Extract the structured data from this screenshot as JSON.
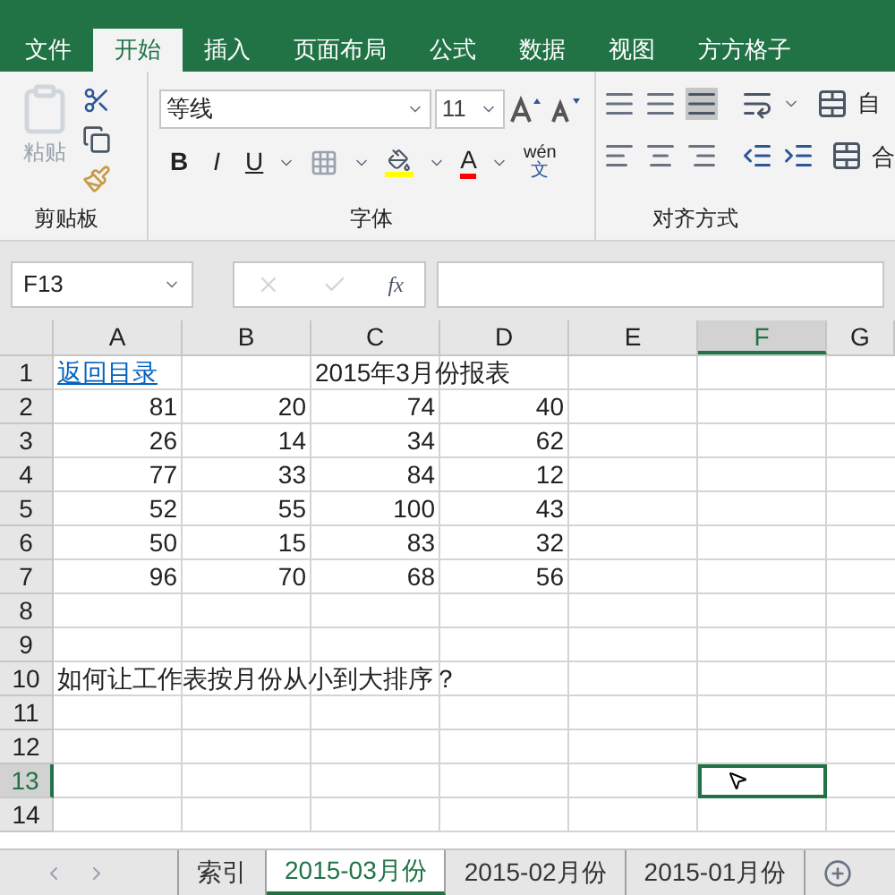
{
  "ribbon_tabs": [
    {
      "label": "文件",
      "selected": false
    },
    {
      "label": "开始",
      "selected": true
    },
    {
      "label": "插入",
      "selected": false
    },
    {
      "label": "页面布局",
      "selected": false
    },
    {
      "label": "公式",
      "selected": false
    },
    {
      "label": "数据",
      "selected": false
    },
    {
      "label": "视图",
      "selected": false
    },
    {
      "label": "方方格子",
      "selected": false
    }
  ],
  "clipboard": {
    "paste": "粘贴",
    "group": "剪贴板"
  },
  "font": {
    "name": "等线",
    "size": "11",
    "phonetic_top": "wén",
    "phonetic_bottom": "文",
    "bold": "B",
    "italic": "I",
    "underline": "U",
    "font_color": "A",
    "group": "字体"
  },
  "alignment": {
    "wrap_cut": "自",
    "merge_cut": "合",
    "group": "对齐方式"
  },
  "formula_bar": {
    "name_box": "F13",
    "fx": "fx"
  },
  "columns": [
    {
      "label": "A",
      "selected": false
    },
    {
      "label": "B",
      "selected": false
    },
    {
      "label": "C",
      "selected": false
    },
    {
      "label": "D",
      "selected": false
    },
    {
      "label": "E",
      "selected": false
    },
    {
      "label": "F",
      "selected": true
    },
    {
      "label": "G",
      "selected": false
    }
  ],
  "rows": [
    {
      "label": "1",
      "selected": false,
      "cells": [
        {
          "text": "返回目录",
          "kind": "link"
        },
        null,
        {
          "text": "2015年3月份报表",
          "kind": "text"
        },
        null,
        null,
        null,
        null
      ]
    },
    {
      "label": "2",
      "selected": false,
      "cells": [
        {
          "text": "81",
          "kind": "number"
        },
        {
          "text": "20",
          "kind": "number"
        },
        {
          "text": "74",
          "kind": "number"
        },
        {
          "text": "40",
          "kind": "number"
        },
        null,
        null,
        null
      ]
    },
    {
      "label": "3",
      "selected": false,
      "cells": [
        {
          "text": "26",
          "kind": "number"
        },
        {
          "text": "14",
          "kind": "number"
        },
        {
          "text": "34",
          "kind": "number"
        },
        {
          "text": "62",
          "kind": "number"
        },
        null,
        null,
        null
      ]
    },
    {
      "label": "4",
      "selected": false,
      "cells": [
        {
          "text": "77",
          "kind": "number"
        },
        {
          "text": "33",
          "kind": "number"
        },
        {
          "text": "84",
          "kind": "number"
        },
        {
          "text": "12",
          "kind": "number"
        },
        null,
        null,
        null
      ]
    },
    {
      "label": "5",
      "selected": false,
      "cells": [
        {
          "text": "52",
          "kind": "number"
        },
        {
          "text": "55",
          "kind": "number"
        },
        {
          "text": "100",
          "kind": "number"
        },
        {
          "text": "43",
          "kind": "number"
        },
        null,
        null,
        null
      ]
    },
    {
      "label": "6",
      "selected": false,
      "cells": [
        {
          "text": "50",
          "kind": "number"
        },
        {
          "text": "15",
          "kind": "number"
        },
        {
          "text": "83",
          "kind": "number"
        },
        {
          "text": "32",
          "kind": "number"
        },
        null,
        null,
        null
      ]
    },
    {
      "label": "7",
      "selected": false,
      "cells": [
        {
          "text": "96",
          "kind": "number"
        },
        {
          "text": "70",
          "kind": "number"
        },
        {
          "text": "68",
          "kind": "number"
        },
        {
          "text": "56",
          "kind": "number"
        },
        null,
        null,
        null
      ]
    },
    {
      "label": "8",
      "selected": false,
      "cells": [
        null,
        null,
        null,
        null,
        null,
        null,
        null
      ]
    },
    {
      "label": "9",
      "selected": false,
      "cells": [
        null,
        null,
        null,
        null,
        null,
        null,
        null
      ]
    },
    {
      "label": "10",
      "selected": false,
      "cells": [
        {
          "text": "如何让工作表按月份从小到大排序？",
          "kind": "text"
        },
        null,
        null,
        null,
        null,
        null,
        null
      ]
    },
    {
      "label": "11",
      "selected": false,
      "cells": [
        null,
        null,
        null,
        null,
        null,
        null,
        null
      ]
    },
    {
      "label": "12",
      "selected": false,
      "cells": [
        null,
        null,
        null,
        null,
        null,
        null,
        null
      ]
    },
    {
      "label": "13",
      "selected": true,
      "cells": [
        null,
        null,
        null,
        null,
        null,
        null,
        null
      ]
    },
    {
      "label": "14",
      "selected": false,
      "cells": [
        null,
        null,
        null,
        null,
        null,
        null,
        null
      ]
    }
  ],
  "sheet_tabs": [
    {
      "label": "索引",
      "selected": false
    },
    {
      "label": "2015-03月份",
      "selected": true
    },
    {
      "label": "2015-02月份",
      "selected": false
    },
    {
      "label": "2015-01月份",
      "selected": false
    }
  ]
}
